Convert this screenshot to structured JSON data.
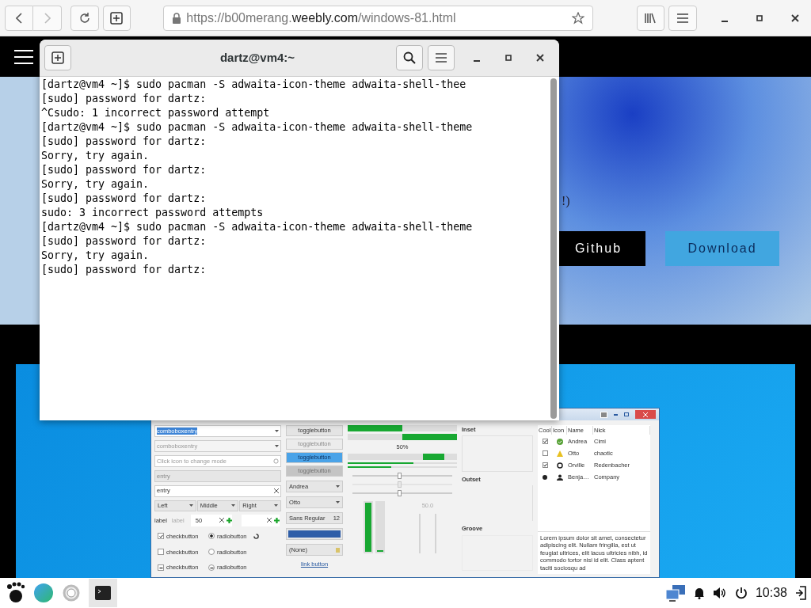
{
  "browser": {
    "url": {
      "scheme": "https://b00merang.",
      "domain": "weebly.com",
      "path": "/windows-81.html"
    }
  },
  "page": {
    "hero_text": "!)",
    "buttons": [
      {
        "label": "Github",
        "kind": "dark"
      },
      {
        "label": "Download",
        "kind": "accent"
      }
    ]
  },
  "widget_factory": {
    "combo_entries": [
      {
        "value": "comboboxentry",
        "highlighted": true,
        "disabled": false
      },
      {
        "value": "comboboxentry",
        "highlighted": false,
        "disabled": true
      }
    ],
    "entries": [
      {
        "placeholder": "Click icon to change mode",
        "disabled": false,
        "kind": "mode"
      },
      {
        "value": "entry",
        "disabled": true,
        "kind": "plain"
      },
      {
        "value": "entry",
        "disabled": false,
        "kind": "clear"
      }
    ],
    "align_combos": [
      "Left",
      "Middle",
      "Right"
    ],
    "labels": [
      {
        "text": "label",
        "disabled": false
      },
      {
        "text": "label",
        "disabled": true
      }
    ],
    "spin_value": "50",
    "checks": [
      {
        "label": "checkbutton",
        "checked": true,
        "inconsistent": false
      },
      {
        "label": "checkbutton",
        "checked": false,
        "inconsistent": false
      },
      {
        "label": "checkbutton",
        "inconsistent": true
      }
    ],
    "radios": [
      {
        "label": "radiobutton",
        "checked": true,
        "inconsistent": false
      },
      {
        "label": "radiobutton",
        "checked": false,
        "inconsistent": false
      },
      {
        "label": "radiobutton",
        "inconsistent": true
      }
    ],
    "toggles": [
      {
        "label": "togglebutton",
        "active": false,
        "disabled": false
      },
      {
        "label": "togglebutton",
        "active": false,
        "disabled": true
      },
      {
        "label": "togglebutton",
        "active": true,
        "disabled": false
      },
      {
        "label": "togglebutton",
        "active": true,
        "disabled": true
      }
    ],
    "combos": [
      "Andrea",
      "Otto"
    ],
    "font_button": {
      "name": "Sans Regular",
      "size": "12"
    },
    "file_button": "(None)",
    "link_button": "link button",
    "progress": [
      {
        "level": 0.5,
        "inverted": false
      },
      {
        "level": 0.5,
        "inverted": true
      }
    ],
    "progress_text": "50%",
    "thin_progress": [
      {
        "level": 0.6
      },
      {
        "level": 0.4
      }
    ],
    "sliders": [
      {
        "level": 0.45,
        "disabled": false
      },
      {
        "level": 0.45,
        "disabled": true
      },
      {
        "level": 0.45,
        "disabled": false
      }
    ],
    "vertical_progress": [
      {
        "level": 1.0
      },
      {
        "level": 0.03
      }
    ],
    "scale_value": "50.0",
    "frames": [
      "Inset",
      "Outset",
      "Groove"
    ],
    "tree": {
      "columns": [
        "Cool",
        "Icon",
        "Name",
        "Nick"
      ],
      "rows": [
        {
          "cool": {
            "kind": "check",
            "checked": true
          },
          "kind": "ok",
          "name": "Andrea",
          "nick": "Cimi"
        },
        {
          "cool": {
            "kind": "check",
            "checked": false
          },
          "kind": "warning",
          "name": "Otto",
          "nick": "chaotic"
        },
        {
          "cool": {
            "kind": "check",
            "checked": true
          },
          "kind": "ring",
          "name": "Orville",
          "nick": "Redenbacher"
        },
        {
          "cool": {
            "kind": "radio",
            "checked": true
          },
          "kind": "person",
          "name": "Benja…",
          "nick": "Company"
        }
      ]
    },
    "text_view": "Lorem ipsum dolor sit amet, consectetur adipiscing elit. Nullam fringilla, est ut feugiat ultrices, elit lacus ultricies nibh, id commodo tortor nisi id elit. Class aptent taciti sociosqu ad"
  },
  "terminal": {
    "title": "dartz@vm4:~",
    "lines": [
      "[dartz@vm4 ~]$ sudo pacman -S adwaita-icon-theme adwaita-shell-thee",
      "[sudo] password for dartz:",
      "^Csudo: 1 incorrect password attempt",
      "[dartz@vm4 ~]$ sudo pacman -S adwaita-icon-theme adwaita-shell-theme",
      "[sudo] password for dartz:",
      "Sorry, try again.",
      "[sudo] password for dartz:",
      "Sorry, try again.",
      "[sudo] password for dartz:",
      "sudo: 3 incorrect password attempts",
      "[dartz@vm4 ~]$ sudo pacman -S adwaita-icon-theme adwaita-shell-theme",
      "[sudo] password for dartz:",
      "Sorry, try again.",
      "[sudo] password for dartz:"
    ]
  },
  "taskbar": {
    "clock": "10:38"
  }
}
